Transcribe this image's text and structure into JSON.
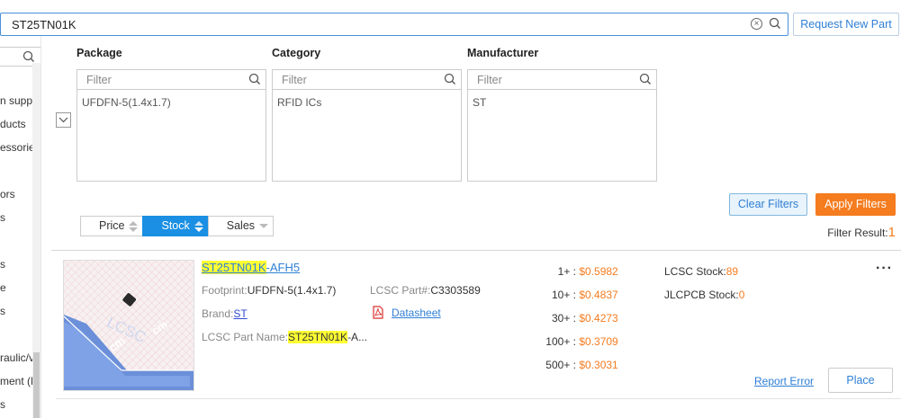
{
  "search": {
    "value": "ST25TN01K"
  },
  "header": {
    "request_new_part": "Request New Part"
  },
  "sidebar": {
    "items": [
      "n suppl",
      "ducts",
      "essorie",
      "ors",
      "s",
      "s",
      "e",
      "s",
      "raulic/v",
      "ment (F",
      "s"
    ]
  },
  "filters": {
    "columns": [
      {
        "title": "Package",
        "placeholder": "Filter",
        "options": [
          "UFDFN-5(1.4x1.7)"
        ]
      },
      {
        "title": "Category",
        "placeholder": "Filter",
        "options": [
          "RFID ICs"
        ]
      },
      {
        "title": "Manufacturer",
        "placeholder": "Filter",
        "options": [
          "ST"
        ]
      }
    ],
    "clear_label": "Clear Filters",
    "apply_label": "Apply Filters",
    "result_label": "Filter Result:",
    "result_count": "1"
  },
  "sort": {
    "tabs": [
      {
        "label": "Price",
        "active": false
      },
      {
        "label": "Stock",
        "active": true
      },
      {
        "label": "Sales",
        "active": false
      }
    ]
  },
  "product": {
    "name_highlight": "ST25TN01K",
    "name_suffix": "-AFH5",
    "footprint_label": "Footprint:",
    "footprint_value": "UFDFN-5(1.4x1.7)",
    "part_label": "LCSC Part#:",
    "part_value": "C3303589",
    "brand_label": "Brand:",
    "brand_value": "ST",
    "datasheet_label": "Datasheet",
    "lcsc_name_label": "LCSC Part Name:",
    "lcsc_name_highlight": "ST25TN01K",
    "lcsc_name_suffix": "-A...",
    "prices": [
      {
        "qty": "1+ :",
        "price": "$0.5982"
      },
      {
        "qty": "10+ :",
        "price": "$0.4837"
      },
      {
        "qty": "30+ :",
        "price": "$0.4273"
      },
      {
        "qty": "100+ :",
        "price": "$0.3709"
      },
      {
        "qty": "500+ :",
        "price": "$0.3031"
      }
    ],
    "lcsc_stock_label": "LCSC Stock:",
    "lcsc_stock_value": "89",
    "jlc_stock_label": "JLCPCB Stock:",
    "jlc_stock_value": "0",
    "more_label": "···",
    "report_error": "Report Error",
    "place_label": "Place",
    "thumb_text": "LCSC",
    "thumb_unit": "cm"
  },
  "colors": {
    "accent": "#1a8fe3",
    "orange": "#f57c1f",
    "link": "#2f7fd5"
  }
}
